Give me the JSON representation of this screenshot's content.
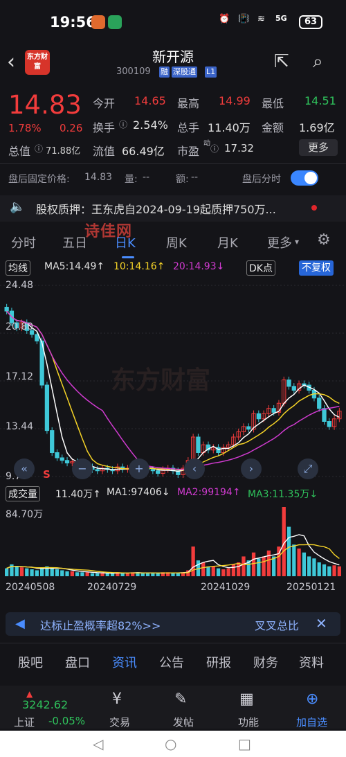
{
  "status": {
    "time": "19:56",
    "signal": "5G",
    "battery": "63"
  },
  "header": {
    "title": "新开源",
    "code": "300109",
    "tags": [
      "融",
      "深股通",
      "L1"
    ],
    "logo_text": "东方财富"
  },
  "quote": {
    "price": "14.83",
    "change_pct": "1.78%",
    "change": "0.26",
    "open_label": "今开",
    "open": "14.65",
    "high_label": "最高",
    "high": "14.99",
    "low_label": "最低",
    "low": "14.51",
    "turnover_label": "换手",
    "turnover": "2.54%",
    "volume_label": "总手",
    "volume": "11.40万",
    "amount_label": "金额",
    "amount": "1.69亿",
    "mktcap_label": "总值",
    "mktcap": "71.88亿",
    "float_label": "流值",
    "float": "66.49亿",
    "pe_label": "市盈",
    "pe_sup": "动",
    "pe": "17.32",
    "more_label": "更多"
  },
  "after_hours": {
    "price_label": "盘后固定价格:",
    "price": "14.83",
    "vol_label": "量:",
    "vol": "--",
    "amt_label": "额:",
    "amt": "--",
    "timeshare_label": "盘后分时"
  },
  "news": {
    "text": "股权质押：王东虎自2024-09-19起质押750万..."
  },
  "watermarks": {
    "top": "诗佳网",
    "chart": "东方财富"
  },
  "period_tabs": [
    "分时",
    "五日",
    "日K",
    "周K",
    "月K",
    "更多"
  ],
  "active_tab": "日K",
  "ma_row": {
    "label": "均线",
    "ma5": "MA5:14.49↑",
    "ma10": "10:14.16↑",
    "ma20": "20:14.93↓",
    "dk": "DK点",
    "fq": "不复权"
  },
  "vol_row": {
    "label": "成交量",
    "vol": "11.40万↑",
    "ma1": "MA1:97406↓",
    "ma2": "MA2:99194↑",
    "ma3": "MA3:11.35万↓",
    "max": "84.70万"
  },
  "colors": {
    "up": "#f23c3c",
    "down": "#2fc35c",
    "accent": "#4a8dff",
    "ma5": "#ffffff",
    "ma10": "#f5d327",
    "ma20": "#d13bd1"
  },
  "chart_data": {
    "type": "candlestick",
    "y_ticks": [
      "24.48",
      "20.80",
      "17.12",
      "13.44",
      "9.76"
    ],
    "ylim": [
      9.76,
      24.48
    ],
    "x_ticks": [
      "20240508",
      "20240729",
      "20241029",
      "20250121"
    ],
    "close": [
      22.5,
      21.6,
      21.2,
      21.6,
      21.0,
      20.7,
      20.2,
      16.8,
      13.3,
      11.6,
      11.2,
      11.0,
      10.8,
      10.9,
      10.6,
      10.4,
      10.5,
      10.3,
      10.2,
      10.4,
      10.3,
      10.2,
      10.5,
      10.3,
      10.4,
      10.6,
      10.5,
      10.4,
      10.3,
      10.2,
      10.0,
      10.3,
      10.4,
      10.2,
      9.9,
      10.4,
      11.0,
      12.8,
      11.6,
      12.2,
      11.8,
      12.0,
      11.6,
      12.0,
      12.2,
      12.8,
      13.2,
      13.6,
      13.4,
      14.6,
      14.2,
      14.6,
      15.0,
      14.7,
      15.4,
      17.2,
      16.7,
      16.4,
      16.9,
      16.8,
      16.4,
      15.8,
      15.0,
      14.0,
      13.6,
      14.2,
      14.8
    ],
    "volume_max_label": "84.70万",
    "volume": [
      8,
      12,
      10,
      9,
      8,
      7,
      6,
      9,
      10,
      8,
      7,
      6,
      5,
      5,
      4,
      4,
      4,
      3,
      3,
      3,
      3,
      3,
      4,
      3,
      3,
      4,
      4,
      3,
      3,
      3,
      3,
      4,
      4,
      3,
      3,
      4,
      6,
      30,
      16,
      14,
      10,
      10,
      8,
      7,
      8,
      12,
      14,
      20,
      16,
      24,
      18,
      20,
      26,
      20,
      30,
      70,
      50,
      32,
      28,
      24,
      20,
      18,
      14,
      12,
      10,
      11,
      10
    ],
    "series": [
      {
        "name": "MA5"
      },
      {
        "name": "MA10"
      },
      {
        "name": "MA20"
      }
    ]
  },
  "promo": {
    "text": "达标止盈概率超82%>>",
    "cta": "叉叉总比"
  },
  "bottom_tabs": [
    "股吧",
    "盘口",
    "资讯",
    "公告",
    "研报",
    "财务",
    "资料"
  ],
  "bottom_active": "资讯",
  "bottom_nav": {
    "index_value": "3242.62",
    "index_label": "上证",
    "index_change": "-0.05%",
    "items": [
      "交易",
      "发帖",
      "功能",
      "加自选"
    ]
  }
}
